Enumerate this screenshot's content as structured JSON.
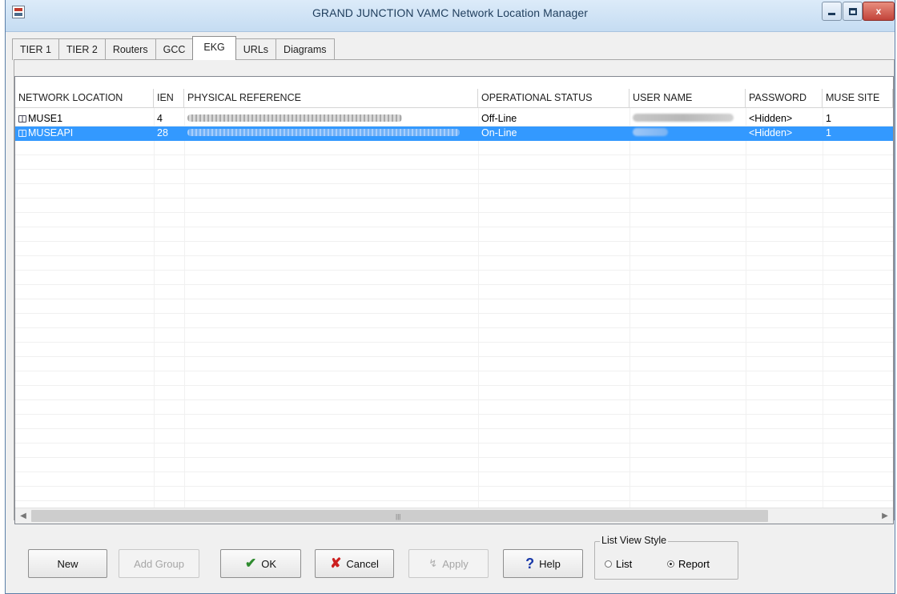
{
  "window": {
    "title": "GRAND JUNCTION VAMC Network Location Manager",
    "controls": {
      "minimize": "–",
      "maximize": "□",
      "close": "x"
    }
  },
  "tabs": [
    {
      "label": "TIER 1",
      "active": false
    },
    {
      "label": "TIER 2",
      "active": false
    },
    {
      "label": "Routers",
      "active": false
    },
    {
      "label": "GCC",
      "active": false
    },
    {
      "label": "EKG",
      "active": true
    },
    {
      "label": "URLs",
      "active": false
    },
    {
      "label": "Diagrams",
      "active": false
    }
  ],
  "list": {
    "columns": [
      "NETWORK LOCATION",
      "IEN",
      "PHYSICAL REFERENCE",
      "OPERATIONAL STATUS",
      "USER NAME",
      "PASSWORD",
      "MUSE SITE"
    ],
    "rows": [
      {
        "network_location": "MUSE1",
        "ien": "4",
        "physical_reference": "[redacted]",
        "operational_status": "Off-Line",
        "user_name": "[redacted]",
        "password": "<Hidden>",
        "muse_site": "1",
        "selected": false
      },
      {
        "network_location": "MUSEAPI",
        "ien": "28",
        "physical_reference": "[redacted]",
        "operational_status": "On-Line",
        "user_name": "[redacted]",
        "password": "<Hidden>",
        "muse_site": "1",
        "selected": true
      }
    ]
  },
  "buttons": {
    "new": "New",
    "add_group": "Add Group",
    "ok": "OK",
    "cancel": "Cancel",
    "apply": "Apply",
    "help": "Help"
  },
  "icons": {
    "ok": "check-icon",
    "cancel": "x-icon",
    "apply": "apply-icon",
    "help": "question-icon",
    "row": "network-location-icon"
  },
  "list_view_style": {
    "label": "List View Style",
    "options": [
      {
        "label": "List",
        "checked": false
      },
      {
        "label": "Report",
        "checked": true
      }
    ]
  },
  "colors": {
    "selection": "#3399ff",
    "ok_icon": "#2e8b2e",
    "cancel_icon": "#cc1f1f",
    "help_icon": "#1838a8"
  }
}
